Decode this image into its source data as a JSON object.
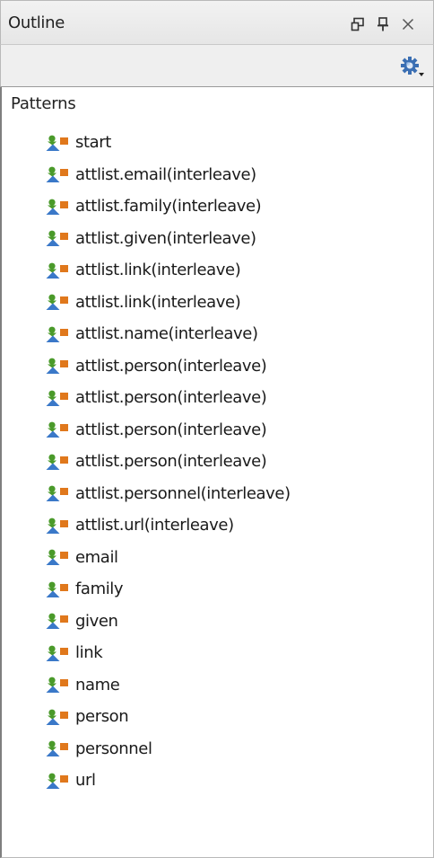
{
  "window": {
    "title": "Outline",
    "restore_icon": "restore-window-icon",
    "pin_icon": "pin-icon",
    "close_icon": "close-icon",
    "settings_icon": "settings-gear-icon"
  },
  "tree": {
    "root_label": "Patterns",
    "items": [
      {
        "label": "start"
      },
      {
        "label": "attlist.email(interleave)"
      },
      {
        "label": "attlist.family(interleave)"
      },
      {
        "label": "attlist.given(interleave)"
      },
      {
        "label": "attlist.link(interleave)"
      },
      {
        "label": "attlist.link(interleave)"
      },
      {
        "label": "attlist.name(interleave)"
      },
      {
        "label": "attlist.person(interleave)"
      },
      {
        "label": "attlist.person(interleave)"
      },
      {
        "label": "attlist.person(interleave)"
      },
      {
        "label": "attlist.person(interleave)"
      },
      {
        "label": "attlist.personnel(interleave)"
      },
      {
        "label": "attlist.url(interleave)"
      },
      {
        "label": "email"
      },
      {
        "label": "family"
      },
      {
        "label": "given"
      },
      {
        "label": "link"
      },
      {
        "label": "name"
      },
      {
        "label": "person"
      },
      {
        "label": "personnel"
      },
      {
        "label": "url"
      }
    ],
    "item_icon": "pattern-icon"
  },
  "colors": {
    "icon_green": "#4a9a2a",
    "icon_blue": "#3a78c8",
    "icon_orange": "#e0781c",
    "gear_blue": "#3b6fb3"
  }
}
